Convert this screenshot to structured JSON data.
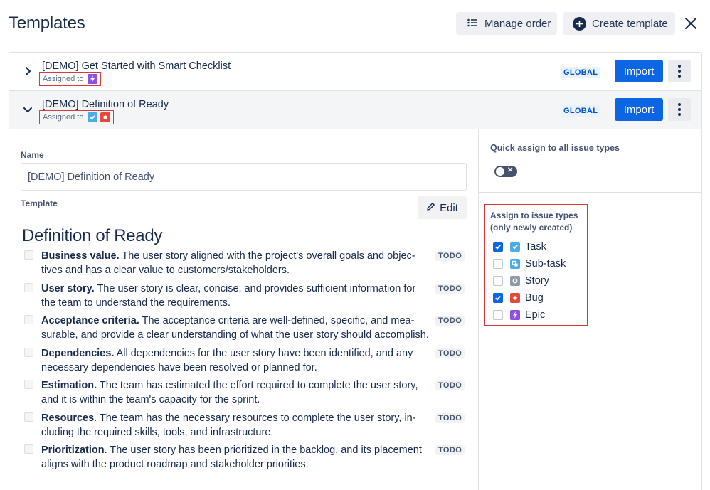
{
  "header": {
    "title": "Templates",
    "manage_order": "Manage order",
    "create_template": "Create template"
  },
  "templates": [
    {
      "title": "[DEMO] Get Started with Smart Checklist",
      "assigned_label": "Assigned to",
      "assigned_icons": [
        "epic-icon"
      ],
      "scope": "GLOBAL",
      "import_label": "Import",
      "expanded": false
    },
    {
      "title": "[DEMO] Definition of Ready",
      "assigned_label": "Assigned to",
      "assigned_icons": [
        "task-icon",
        "bug-icon"
      ],
      "scope": "GLOBAL",
      "import_label": "Import",
      "expanded": true
    }
  ],
  "editor": {
    "name_label": "Name",
    "name_value": "[DEMO] Definition of Ready",
    "template_label": "Template",
    "edit_label": "Edit",
    "heading": "Definition of Ready",
    "items": [
      {
        "bold": "Business value.",
        "line1": " The user story aligned with the project's overall goals and objec-",
        "line2": "tives and has a clear value to customers/stakeholders.",
        "status": "TODO"
      },
      {
        "bold": "User story.",
        "line1": " The user story is clear, concise, and provides sufficient information for",
        "line2": "the team to understand the requirements.",
        "status": "TODO"
      },
      {
        "bold": "Acceptance criteria.",
        "line1": " The acceptance criteria are well-defined, specific, and mea-",
        "line2": "surable, and provide a clear understanding of what the user story should accomplish.",
        "status": "TODO"
      },
      {
        "bold": "Dependencies.",
        "line1": " All dependencies for the user story have been identified, and any",
        "line2": "necessary dependencies have been resolved or planned for.",
        "status": "TODO"
      },
      {
        "bold": "Estimation.",
        "line1": " The team has estimated the effort required to complete the user story,",
        "line2": "and it is within the team's capacity for the sprint.",
        "status": "TODO"
      },
      {
        "bold": "Resources",
        "line1": ". The team has the necessary resources to complete the user story, in-",
        "line2": "cluding the required skills, tools, and infrastructure.",
        "status": "TODO"
      },
      {
        "bold": "Prioritization",
        "line1": ". The user story has been prioritized in the backlog, and its placement",
        "line2": "aligns with the product roadmap and stakeholder priorities.",
        "status": "TODO"
      }
    ]
  },
  "assign": {
    "quick_label": "Quick assign to all issue types",
    "quick_toggle_on": false,
    "title_line1": "Assign to issue types",
    "title_line2": "(only newly created)",
    "issue_types": [
      {
        "label": "Task",
        "icon": "task-icon",
        "color": "#4bade8",
        "checked": true
      },
      {
        "label": "Sub-task",
        "icon": "subtask-icon",
        "color": "#4bade8",
        "checked": false
      },
      {
        "label": "Story",
        "icon": "story-icon",
        "color": "#8c9bab",
        "checked": false
      },
      {
        "label": "Bug",
        "icon": "bug-icon",
        "color": "#e5493a",
        "checked": true
      },
      {
        "label": "Epic",
        "icon": "epic-icon",
        "color": "#904ee2",
        "checked": false
      }
    ]
  },
  "colors": {
    "primary": "#0c66e4",
    "highlight_border": "#d63a3a",
    "global_badge_bg": "#e9f2ff",
    "global_badge_text": "#0052cc"
  }
}
